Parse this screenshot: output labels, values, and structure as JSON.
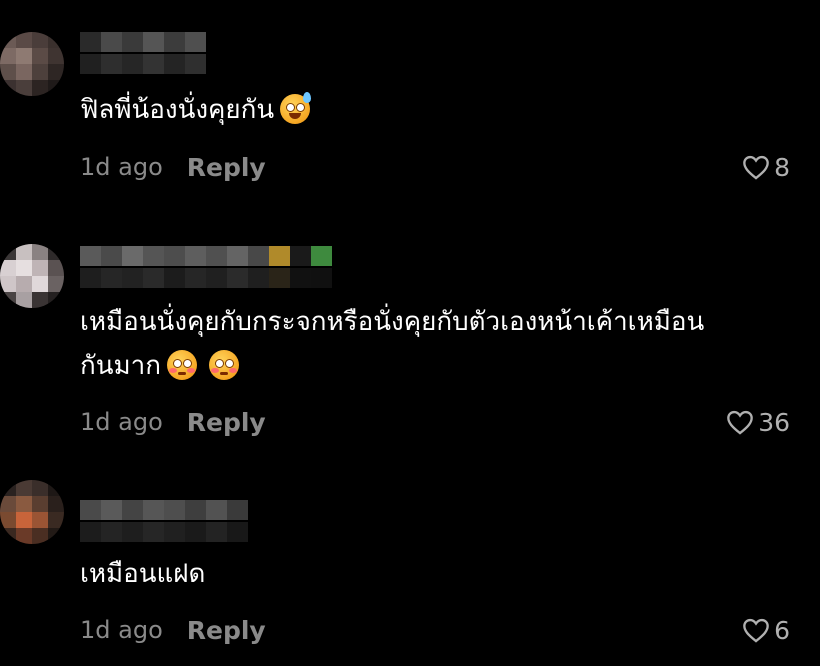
{
  "comments": [
    {
      "text": "ฟิลพี่น้องนั่งคุยกัน",
      "emoji": "grinning-sweat-emoji",
      "time": "1d ago",
      "reply_label": "Reply",
      "likes": "8"
    },
    {
      "text_line1": "เหมือนนั่งคุยกับกระจกหรือนั่งคุยกับตัวเองหน้าเค้าเหมือน",
      "text_line2": "กันมาก",
      "emoji": "flushed-face-emoji",
      "time": "1d ago",
      "reply_label": "Reply",
      "likes": "36"
    },
    {
      "text": "เหมือนแฝด",
      "time": "1d ago",
      "reply_label": "Reply",
      "likes": "6"
    }
  ],
  "colors": {
    "background": "#000000",
    "text": "#ffffff",
    "muted": "#8a8a8a",
    "heart": "#b0b0b0"
  }
}
